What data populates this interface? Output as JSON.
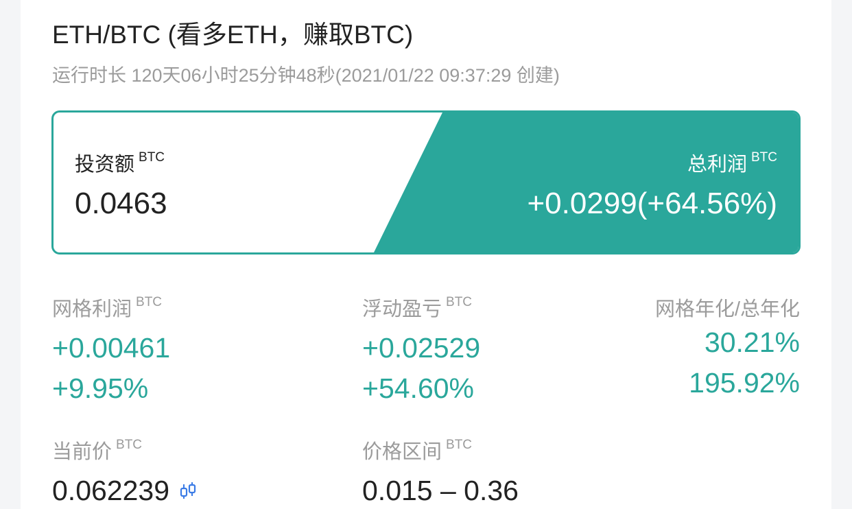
{
  "header": {
    "title": "ETH/BTC (看多ETH，赚取BTC)",
    "runtime": "运行时长 120天06小时25分钟48秒(2021/01/22 09:37:29 创建)"
  },
  "summary": {
    "invest_label": "投资额",
    "invest_unit": "BTC",
    "invest_value": "0.0463",
    "profit_label": "总利润",
    "profit_unit": "BTC",
    "profit_value": "+0.0299(+64.56%)"
  },
  "stats": {
    "grid_profit": {
      "label": "网格利润",
      "unit": "BTC",
      "value": "+0.00461",
      "percent": "+9.95%"
    },
    "floating_pnl": {
      "label": "浮动盈亏",
      "unit": "BTC",
      "value": "+0.02529",
      "percent": "+54.60%"
    },
    "annualized": {
      "label": "网格年化/总年化",
      "grid": "30.21%",
      "total": "195.92%"
    },
    "current_price": {
      "label": "当前价",
      "unit": "BTC",
      "value": "0.062239"
    },
    "price_range": {
      "label": "价格区间",
      "unit": "BTC",
      "value": "0.015 – 0.36"
    }
  },
  "icons": {
    "current_price_action": "candlestick-chart-icon"
  },
  "colors": {
    "accent": "#2aa79b",
    "text_primary": "#222222",
    "text_secondary": "#9b9b9b",
    "icon_blue": "#3a7be6"
  }
}
